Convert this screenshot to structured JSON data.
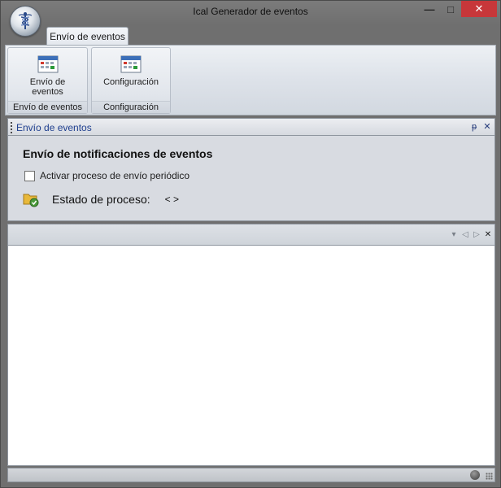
{
  "window": {
    "title": "Ical Generador de eventos",
    "minimize_symbol": "—",
    "maximize_symbol": "□",
    "close_symbol": "✕",
    "close_color": "#c7373a"
  },
  "ribbon": {
    "tabs": [
      {
        "label": "Envío de eventos",
        "active": true
      }
    ],
    "groups": [
      {
        "button_label": "Envío de\neventos",
        "group_label": "Envío de eventos",
        "icon": "calendar-icon"
      },
      {
        "button_label": "Configuración",
        "group_label": "Configuración",
        "icon": "calendar-icon"
      }
    ]
  },
  "panel": {
    "title": "Envío de eventos",
    "pin_symbol": "ᵽ",
    "close_symbol": "✕",
    "heading": "Envío de notificaciones de eventos",
    "checkbox_label": "Activar proceso de envío periódico",
    "checkbox_checked": false,
    "status_label": "Estado de proceso:",
    "status_value": "< >"
  },
  "doc_strip": {
    "dropdown_symbol": "▾",
    "prev_symbol": "◁",
    "next_symbol": "▷",
    "close_symbol": "✕"
  },
  "colors": {
    "panel_title": "#1f3f8f",
    "window_frame": "#6f6f6f",
    "ribbon_bg": "#dde2e9"
  }
}
